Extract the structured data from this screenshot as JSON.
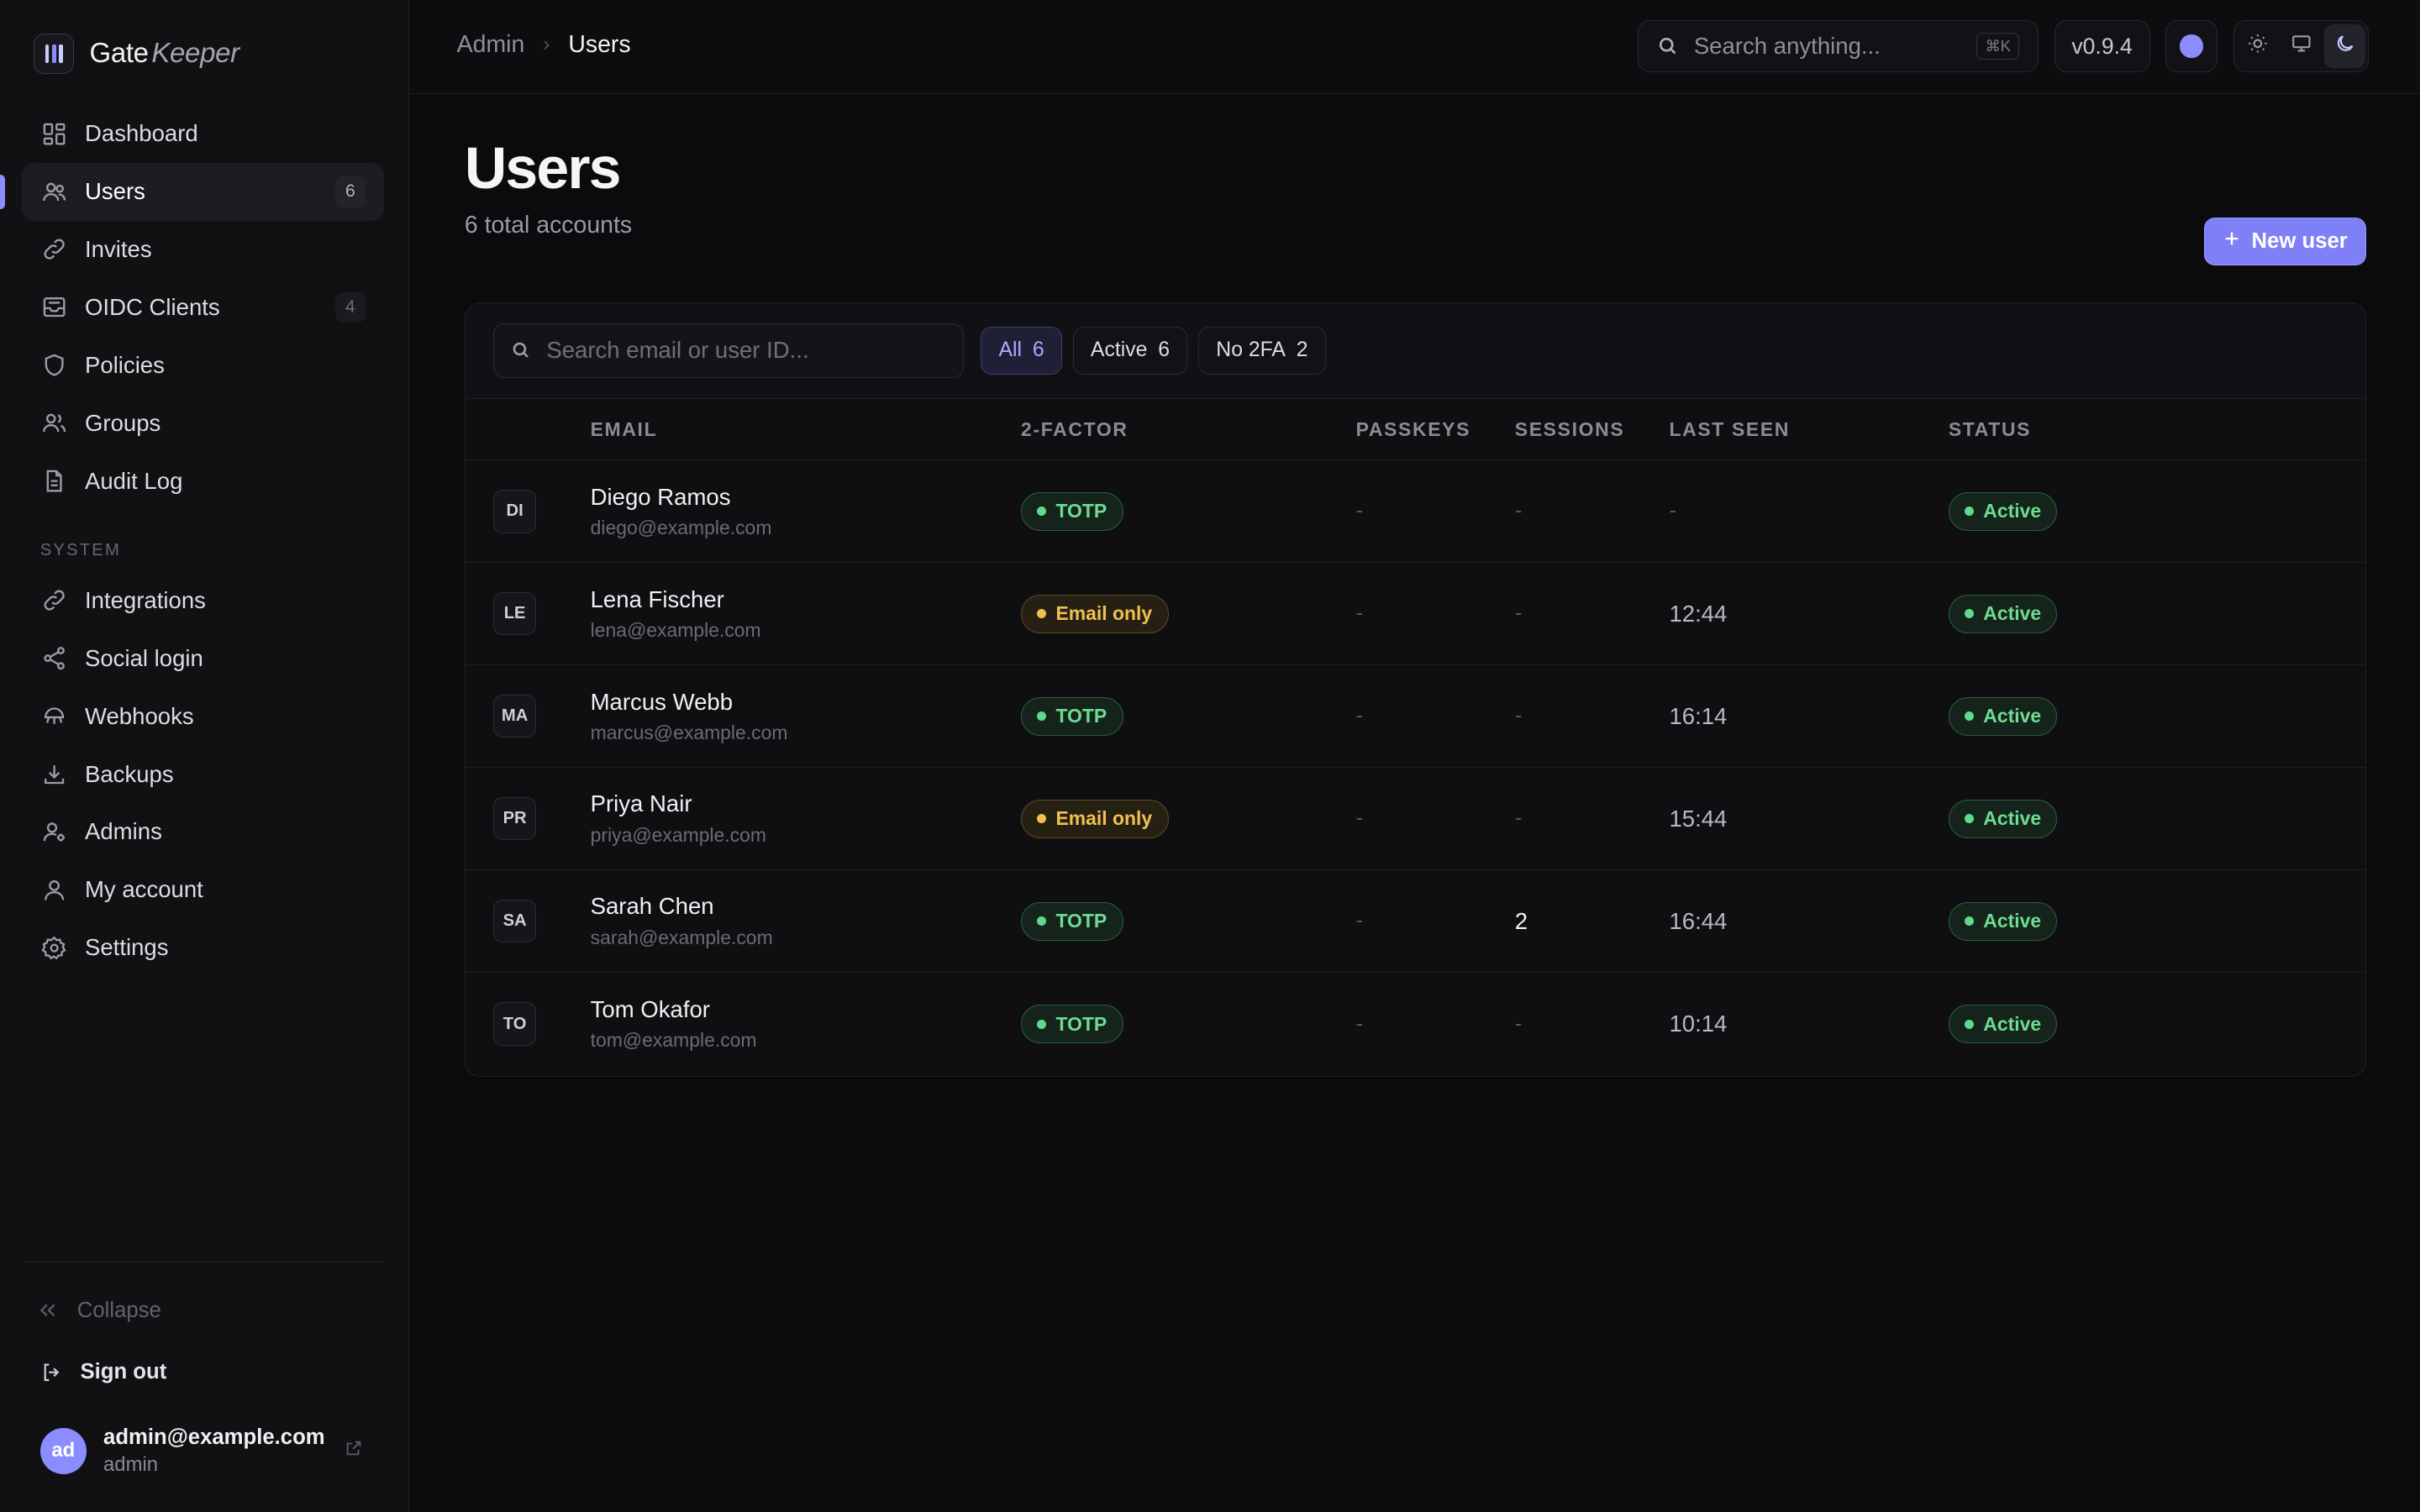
{
  "brand": {
    "name_a": "Gate",
    "name_b": "Keeper"
  },
  "sidebar": {
    "items": [
      {
        "label": "Dashboard",
        "icon": "dashboard-icon"
      },
      {
        "label": "Users",
        "icon": "users-icon",
        "count": "6",
        "active": true
      },
      {
        "label": "Invites",
        "icon": "link-icon"
      },
      {
        "label": "OIDC Clients",
        "icon": "inbox-icon",
        "count": "4"
      },
      {
        "label": "Policies",
        "icon": "shield-icon"
      },
      {
        "label": "Groups",
        "icon": "group-icon"
      },
      {
        "label": "Audit Log",
        "icon": "document-icon"
      }
    ],
    "section_label": "SYSTEM",
    "system_items": [
      {
        "label": "Integrations",
        "icon": "link-icon"
      },
      {
        "label": "Social login",
        "icon": "share-icon"
      },
      {
        "label": "Webhooks",
        "icon": "webhook-icon"
      },
      {
        "label": "Backups",
        "icon": "download-icon"
      },
      {
        "label": "Admins",
        "icon": "user-cog-icon"
      },
      {
        "label": "My account",
        "icon": "user-icon"
      },
      {
        "label": "Settings",
        "icon": "gear-icon"
      }
    ],
    "collapse_label": "Collapse",
    "signout_label": "Sign out",
    "account": {
      "initials": "ad",
      "email": "admin@example.com",
      "role": "admin"
    }
  },
  "topbar": {
    "breadcrumb": [
      "Admin",
      "Users"
    ],
    "search_placeholder": "Search anything...",
    "search_shortcut": "⌘K",
    "version": "v0.9.4"
  },
  "page": {
    "title": "Users",
    "subtitle": "6 total accounts",
    "new_user_label": "New user"
  },
  "table": {
    "search_placeholder": "Search email or user ID...",
    "filters": [
      {
        "label": "All",
        "count": "6"
      },
      {
        "label": "Active",
        "count": "6"
      },
      {
        "label": "No 2FA",
        "count": "2"
      }
    ],
    "headers": [
      "EMAIL",
      "2-FACTOR",
      "PASSKEYS",
      "SESSIONS",
      "LAST SEEN",
      "STATUS"
    ],
    "rows": [
      {
        "initials": "DI",
        "name": "Diego Ramos",
        "email": "diego@example.com",
        "twofa": "TOTP",
        "twofa_kind": "green",
        "passkeys": "-",
        "sessions": "-",
        "last_seen": "-",
        "status": "Active"
      },
      {
        "initials": "LE",
        "name": "Lena Fischer",
        "email": "lena@example.com",
        "twofa": "Email only",
        "twofa_kind": "amber",
        "passkeys": "-",
        "sessions": "-",
        "last_seen": "12:44",
        "status": "Active"
      },
      {
        "initials": "MA",
        "name": "Marcus Webb",
        "email": "marcus@example.com",
        "twofa": "TOTP",
        "twofa_kind": "green",
        "passkeys": "-",
        "sessions": "-",
        "last_seen": "16:14",
        "status": "Active"
      },
      {
        "initials": "PR",
        "name": "Priya Nair",
        "email": "priya@example.com",
        "twofa": "Email only",
        "twofa_kind": "amber",
        "passkeys": "-",
        "sessions": "-",
        "last_seen": "15:44",
        "status": "Active"
      },
      {
        "initials": "SA",
        "name": "Sarah Chen",
        "email": "sarah@example.com",
        "twofa": "TOTP",
        "twofa_kind": "green",
        "passkeys": "-",
        "sessions": "2",
        "last_seen": "16:44",
        "status": "Active"
      },
      {
        "initials": "TO",
        "name": "Tom Okafor",
        "email": "tom@example.com",
        "twofa": "TOTP",
        "twofa_kind": "green",
        "passkeys": "-",
        "sessions": "-",
        "last_seen": "10:14",
        "status": "Active"
      }
    ]
  },
  "colors": {
    "accent": "#8b8dff",
    "success": "#6ddc92",
    "warning": "#f0c050",
    "background": "#0b0b0d"
  }
}
